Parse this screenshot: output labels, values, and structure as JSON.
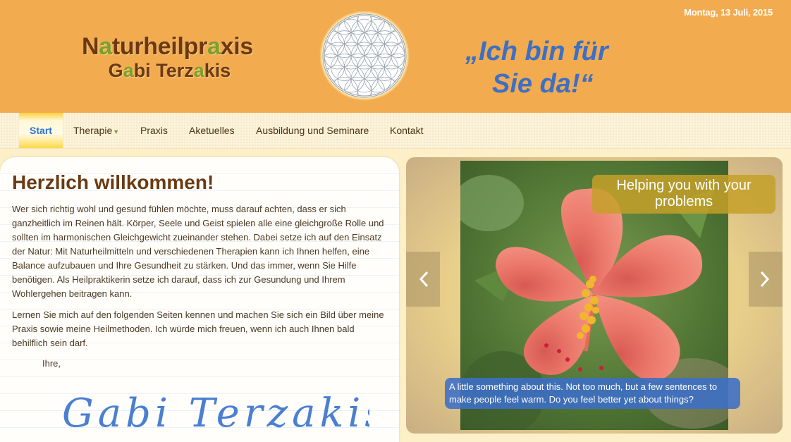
{
  "header": {
    "date": "Montag, 13 Juli, 2015",
    "brand_line1": [
      "N",
      "a",
      "turheilpr",
      "a",
      "xis"
    ],
    "brand_line2": [
      "G",
      "a",
      "bi Terz",
      "a",
      "kis"
    ],
    "slogan_line1": "„Ich bin für",
    "slogan_line2": "Sie da!“",
    "logo_icon": "flower-of-life-logo"
  },
  "nav": {
    "items": [
      {
        "label": "Start"
      },
      {
        "label": "Therapie"
      },
      {
        "label": "Praxis"
      },
      {
        "label": "Aketuelles"
      },
      {
        "label": "Ausbildung und Seminare"
      },
      {
        "label": "Kontakt"
      }
    ],
    "dropdown_icon": "caret-down-icon"
  },
  "main": {
    "title": "Herzlich willkommen!",
    "paragraph1": "Wer sich richtig wohl und gesund fühlen möchte, muss darauf achten, dass er sich ganzheitlich im Reinen hält. Körper, Seele und Geist spielen alle eine gleichgroße Rolle und sollten im harmonischen Gleichgewicht zueinander stehen. Dabei setze ich auf den Einsatz der Natur: Mit Naturheilmitteln und verschiedenen Therapien kann ich Ihnen helfen, eine Balance aufzubauen und Ihre Gesundheit zu stärken. Und das immer, wenn Sie Hilfe benötigen. Als Heilpraktikerin setze ich darauf, dass ich zur Gesundung und Ihrem Wohlergehen beitragen kann.",
    "paragraph2": "Lernen Sie mich auf den folgenden Seiten kennen und machen Sie sich ein Bild über meine Praxis sowie meine Heilmethoden. Ich würde mich freuen, wenn ich auch Ihnen bald behilflich sein darf.",
    "greeting": "Ihre,",
    "signature": "Gabi Terzakis"
  },
  "slider": {
    "caption_title": "Helping you with your problems",
    "caption_text": "A little something about this. Not too much, but a few sentences to make people feel warm. Do you feel better yet about things?",
    "prev_icon": "chevron-left-icon",
    "next_icon": "chevron-right-icon",
    "image": "hibiscus-flower-photo"
  },
  "colors": {
    "header_bg": "#f2ab4f",
    "brand": "#6b3a12",
    "brand_accent": "#7aa12d",
    "slogan": "#3d6fc5",
    "nav_active": "#2f73d1"
  }
}
